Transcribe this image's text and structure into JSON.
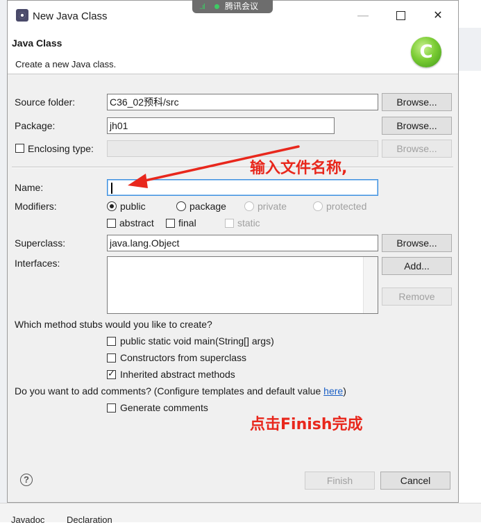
{
  "dialog": {
    "window_title": "New Java Class",
    "header_title": "Java Class",
    "header_description": "Create a new Java class.",
    "logo_letter": "C"
  },
  "meeting_bar": {
    "label": "腾讯会议",
    "signal": "..ıl"
  },
  "form": {
    "source_folder": {
      "label": "Source folder:",
      "value": "C36_02预科/src",
      "button": "Browse..."
    },
    "package": {
      "label": "Package:",
      "value": "jh01",
      "button": "Browse..."
    },
    "enclosing_type": {
      "label": "Enclosing type:",
      "value": "",
      "checked": false,
      "button": "Browse..."
    },
    "name": {
      "label": "Name:",
      "value": ""
    },
    "modifiers": {
      "label": "Modifiers:",
      "access": [
        {
          "label": "public",
          "selected": true,
          "enabled": true
        },
        {
          "label": "package",
          "selected": false,
          "enabled": true
        },
        {
          "label": "private",
          "selected": false,
          "enabled": false
        },
        {
          "label": "protected",
          "selected": false,
          "enabled": false
        }
      ],
      "other": [
        {
          "label": "abstract",
          "checked": false,
          "enabled": true
        },
        {
          "label": "final",
          "checked": false,
          "enabled": true
        },
        {
          "label": "static",
          "checked": false,
          "enabled": false
        }
      ]
    },
    "superclass": {
      "label": "Superclass:",
      "value": "java.lang.Object",
      "button": "Browse..."
    },
    "interfaces": {
      "label": "Interfaces:",
      "add_button": "Add...",
      "remove_button": "Remove",
      "items": []
    },
    "stubs": {
      "question": "Which method stubs would you like to create?",
      "options": [
        {
          "label": "public static void main(String[] args)",
          "checked": false
        },
        {
          "label": "Constructors from superclass",
          "checked": false
        },
        {
          "label": "Inherited abstract methods",
          "checked": true
        }
      ]
    },
    "comments": {
      "question_prefix": "Do you want to add comments? (Configure templates and default value ",
      "question_link": "here",
      "question_suffix": ")",
      "option": {
        "label": "Generate comments",
        "checked": false
      }
    }
  },
  "footer": {
    "finish_button": "Finish",
    "cancel_button": "Cancel",
    "help_symbol": "?"
  },
  "annotations": {
    "name_hint": "输入文件名称,",
    "finish_hint": "点击Finish完成",
    "color": "#e8271c"
  },
  "background_tabs": [
    "Javadoc",
    "Declaration"
  ]
}
